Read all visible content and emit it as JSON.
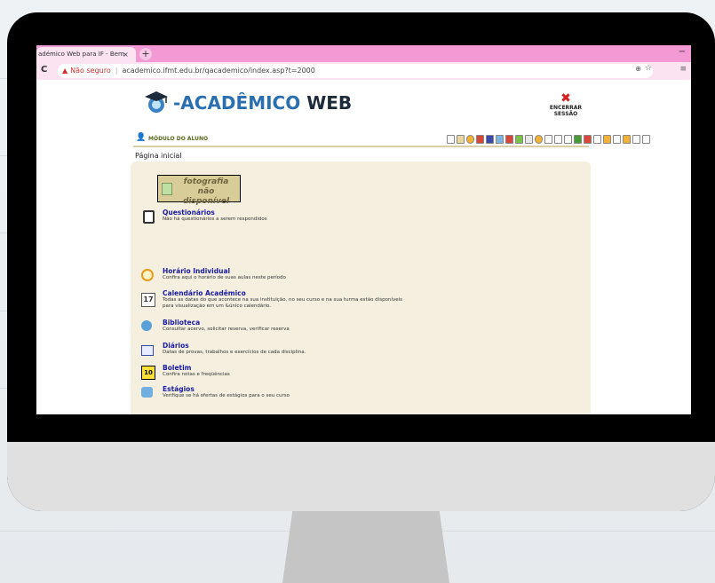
{
  "browser": {
    "tab_title": "adémico Web para IF - Bem",
    "tab_close": "×",
    "new_tab": "+",
    "window_min": "−",
    "reload": "C",
    "security_label": "Não seguro",
    "separator": "|",
    "url": "academico.ifmt.edu.br/qacademico/index.asp?t=2000",
    "zoom_icon": "⊕",
    "star_icon": "☆",
    "menu_icon": "≡"
  },
  "header": {
    "logo_prefix": "-ACADÊMICO",
    "logo_suffix": "WEB",
    "logout_line1": "ENCERRAR",
    "logout_line2": "SESSÃO",
    "module_label": "MÓDULO DO ALUNO"
  },
  "page": {
    "title": "Página inicial",
    "photo_placeholder": "fotografia não disponível"
  },
  "items": [
    {
      "title": "Questionários",
      "desc": "Não há questionários a serem respondidos",
      "icon": "clipboard-icon"
    },
    {
      "title": "Horário Individual",
      "desc": "Confira aqui o horário de suas aulas neste período",
      "icon": "clock-icon"
    },
    {
      "title": "Calendário Acadêmico",
      "desc": "Todas as datas do que acontece na sua instituição, no seu curso e na sua turma estão disponíveis",
      "desc2": "para visualização em um &único calendário.",
      "icon": "calendar-icon"
    },
    {
      "title": "Biblioteca",
      "desc": "Consultar acervo, solicitar reserva, verificar reserva",
      "icon": "book-icon"
    },
    {
      "title": "Diários",
      "desc": "Datas de provas, trabalhos e exercícios de cada disciplina.",
      "icon": "diary-icon"
    },
    {
      "title": "Boletim",
      "desc": "Confira notas e freqüências",
      "icon": "grades-icon"
    },
    {
      "title": "Estágios",
      "desc": "Verifique se há ofertas de estágios para o seu curso",
      "icon": "internship-icon"
    }
  ],
  "colors": {
    "tab_bar": "#f39ad4",
    "content_bg": "#f4efdf",
    "link_blue": "#1a1aa6",
    "logo_blue": "#2a6fb0"
  }
}
